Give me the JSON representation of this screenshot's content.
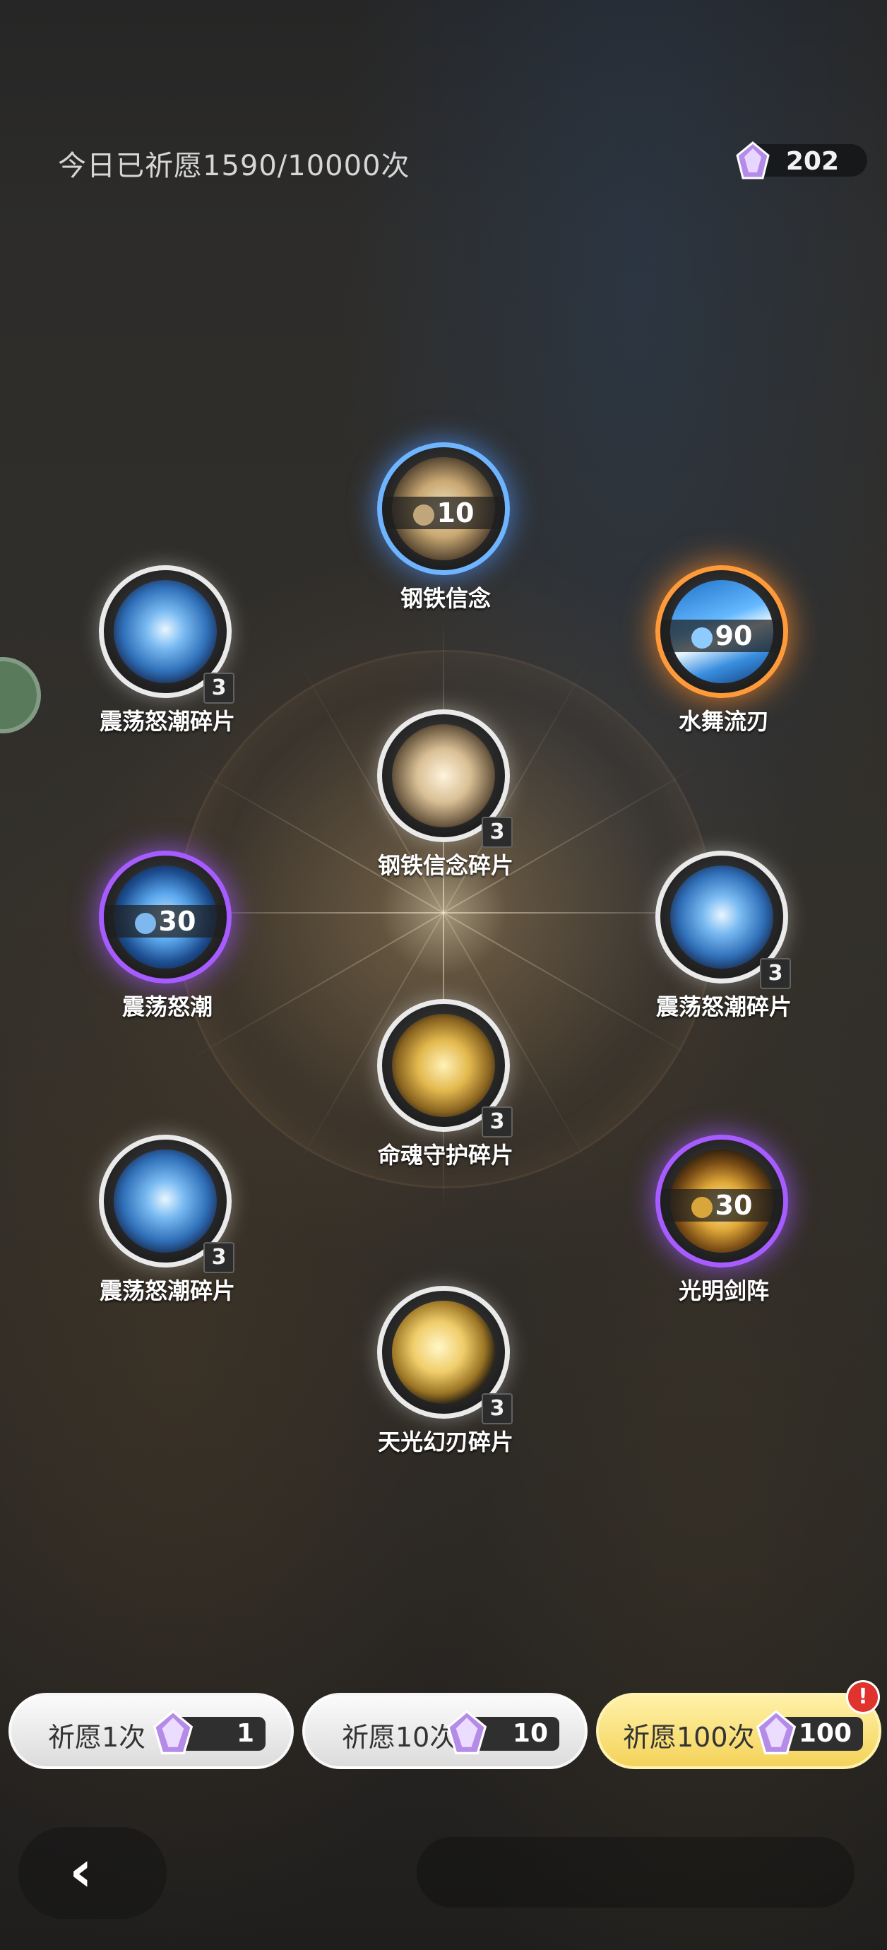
{
  "header": {
    "daily_text": "今日已祈愿1590/10000次",
    "currency_value": "202",
    "currency_icon": "crystal-gem-icon"
  },
  "nodes": [
    {
      "name": "钢铁信念",
      "amount": "10",
      "badge": "",
      "rarity": "blue"
    },
    {
      "name": "震荡怒潮碎片",
      "amount": "",
      "badge": "3",
      "rarity": "white"
    },
    {
      "name": "水舞流刃",
      "amount": "90",
      "badge": "",
      "rarity": "orange"
    },
    {
      "name": "钢铁信念碎片",
      "amount": "",
      "badge": "3",
      "rarity": "white"
    },
    {
      "name": "震荡怒潮",
      "amount": "30",
      "badge": "",
      "rarity": "purple"
    },
    {
      "name": "震荡怒潮碎片",
      "amount": "",
      "badge": "3",
      "rarity": "white"
    },
    {
      "name": "命魂守护碎片",
      "amount": "",
      "badge": "3",
      "rarity": "white"
    },
    {
      "name": "震荡怒潮碎片",
      "amount": "",
      "badge": "3",
      "rarity": "white"
    },
    {
      "name": "光明剑阵",
      "amount": "30",
      "badge": "",
      "rarity": "purple"
    },
    {
      "name": "天光幻刃碎片",
      "amount": "",
      "badge": "3",
      "rarity": "white"
    }
  ],
  "buttons": [
    {
      "label": "祈愿1次",
      "cost": "1"
    },
    {
      "label": "祈愿10次",
      "cost": "10"
    },
    {
      "label": "祈愿100次",
      "cost": "100"
    }
  ],
  "alert_mark": "!",
  "back_icon": "‹",
  "colors": {
    "blue": "#6fb4ff",
    "orange": "#ff9a3a",
    "purple": "#a65cff",
    "gold_button": "#f4d35a"
  }
}
